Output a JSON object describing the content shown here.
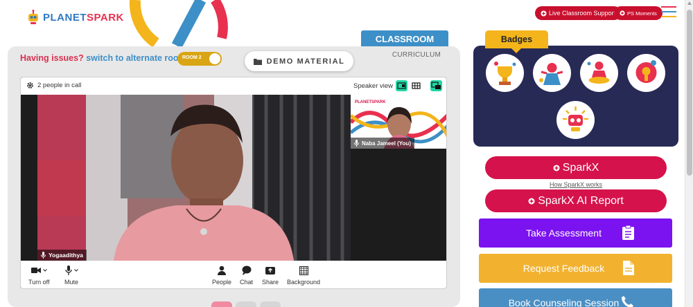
{
  "brand": {
    "name_part1": "PLANET",
    "name_part2": "SPARK"
  },
  "header": {
    "live_support_label": "Live Classroom Support",
    "ps_moments_label": "PS Moments"
  },
  "tabs": {
    "classroom": "CLASSROOM",
    "curriculum": "CURRICULUM"
  },
  "issues": {
    "prefix": "Having issues?",
    "link": "switch to alternate room"
  },
  "room_toggle": {
    "label": "ROOM 2"
  },
  "demo_material": {
    "label": "DEMO MATERIAL"
  },
  "call": {
    "people_count_text": "2 people in call",
    "speaker_view_label": "Speaker view",
    "main_participant": "Yogaadithya",
    "pip_participant": "Naba Jameel (You)",
    "controls": {
      "turn_off": "Turn off",
      "mute": "Mute",
      "people": "People",
      "chat": "Chat",
      "share": "Share",
      "background": "Background"
    }
  },
  "badges": {
    "title": "Badges",
    "items": [
      "trophy-badge",
      "superhero-badge",
      "meditation-badge",
      "idea-badge",
      "robot-badge"
    ]
  },
  "sparkx": {
    "label": "SparkX",
    "how_link": "How SparkX works"
  },
  "sparkx_ai": {
    "label": "SparkX AI Report"
  },
  "actions": {
    "take_assessment": "Take Assessment",
    "request_feedback": "Request Feedback",
    "book_counseling": "Book Counseling Session"
  },
  "colors": {
    "crimson": "#d5124b",
    "purple": "#7b12f0",
    "amber": "#f2b230",
    "blue": "#4a8fc4",
    "navy_panel": "#272a55",
    "badge_tab": "#f3b51b"
  }
}
